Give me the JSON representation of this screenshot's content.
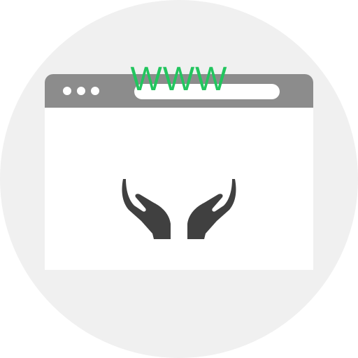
{
  "illustration": {
    "banner_text": "WWW",
    "icon": "hands-holding-web-icon",
    "colors": {
      "circle_background": "#f0f0f0",
      "window_frame": "#8c8c8c",
      "window_body": "#ffffff",
      "text_accent": "#22c55e",
      "hands": "#404040"
    }
  }
}
